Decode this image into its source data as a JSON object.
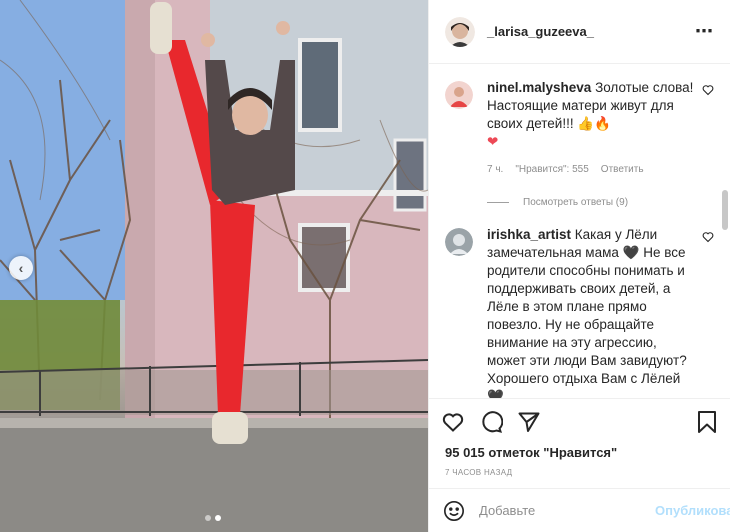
{
  "post": {
    "author": "_larisa_guzeeva_",
    "more_icon": "⋯",
    "carousel": {
      "total_slides": 2,
      "active_slide": 2
    }
  },
  "comments": [
    {
      "author": "ninel.malysheva",
      "text": " Золотые слова! Настоящие матери живут для своих детей!!! 👍🔥",
      "tail": "❤",
      "time": "7 ч.",
      "likes": "\"Нравится\": 555",
      "reply": "Ответить",
      "view_replies": "Посмотреть ответы (9)"
    },
    {
      "author": "irishka_artist",
      "text": " Какая у Лёли замечательная мама 🖤 Не все родители способны понимать и поддерживать своих детей, а Лёле в этом плане прямо повезло. Ну не обращайте внимание на эту агрессию, может эти люди Вам завидуют? Хорошего отдыха Вам с Лёлей 🖤"
    }
  ],
  "actions": {
    "likes_text": "95 015 отметок \"Нравится\"",
    "time_ago": "7 ЧАСОВ НАЗАД"
  },
  "add_comment": {
    "placeholder": "Добавьте комментарий...",
    "placeholder_visible": "Добавьте",
    "publish_label": "Опубликовать"
  },
  "colors": {
    "pants": "#e8282d",
    "sky": "#7da9e0",
    "publish": "#b2dffc"
  }
}
